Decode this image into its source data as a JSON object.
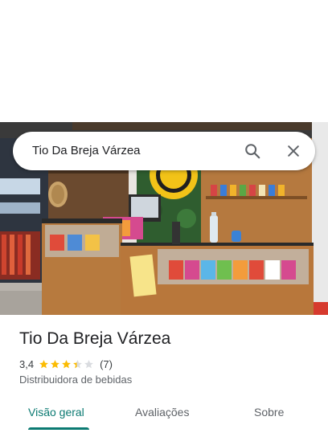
{
  "search": {
    "query": "Tio Da Breja Várzea",
    "search_icon": "search-icon",
    "close_icon": "close-icon"
  },
  "place": {
    "name": "Tio Da Breja Várzea",
    "rating": "3,4",
    "rating_fraction": 0.68,
    "reviews": "(7)",
    "category": "Distribuidora de bebidas"
  },
  "tabs": [
    {
      "label": "Visão geral",
      "active": true
    },
    {
      "label": "Avaliações",
      "active": false
    },
    {
      "label": "Sobre",
      "active": false
    }
  ],
  "colors": {
    "accent": "#0b7a72",
    "star": "#fbbc04",
    "star_empty": "#dadce0"
  }
}
